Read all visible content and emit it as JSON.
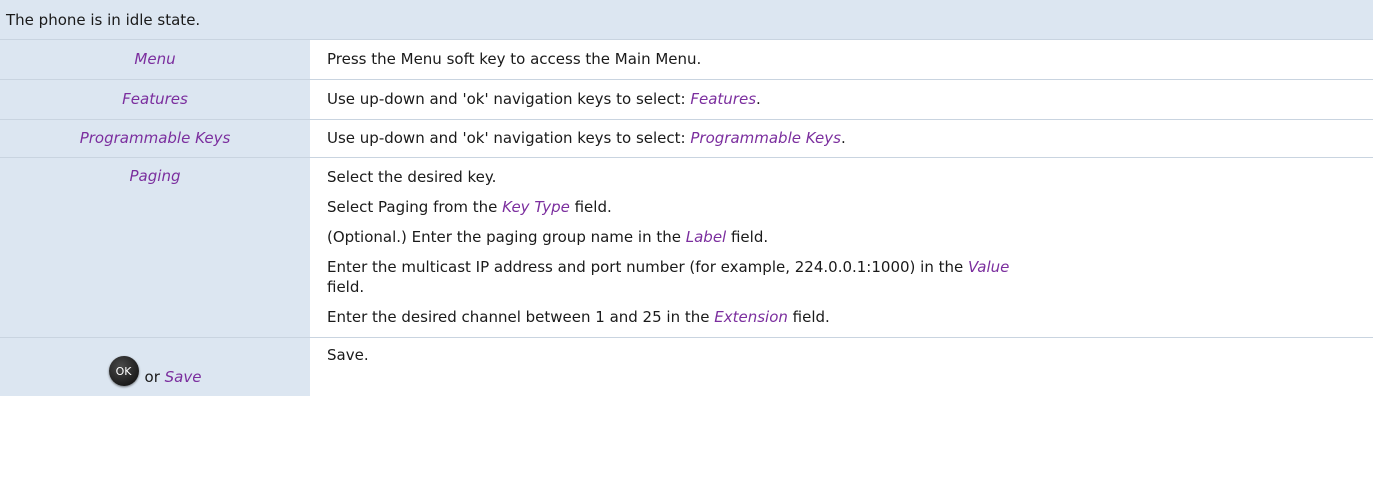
{
  "header": {
    "text": "The phone is in idle state."
  },
  "rows": [
    {
      "key": "Menu",
      "desc": "Press the Menu soft key to access the Main Menu."
    },
    {
      "key": "Features",
      "desc_prefix": "Use up-down and 'ok' navigation keys to select: ",
      "desc_italic": "Features",
      "desc_suffix": "."
    },
    {
      "key": "Programmable Keys",
      "desc_prefix": "Use up-down and 'ok' navigation keys to select: ",
      "desc_italic": "Programmable Keys",
      "desc_suffix": "."
    },
    {
      "key": "Paging",
      "lines": {
        "l1": "Select the desired key.",
        "l2_prefix": "Select Paging from the ",
        "l2_italic": "Key Type",
        "l2_suffix": " field.",
        "l3_prefix": "(Optional.) Enter the paging group name in the ",
        "l3_italic": "Label",
        "l3_suffix": " field.",
        "l4_prefix": "Enter the multicast IP address and port number (for example, 224.0.0.1:1000) in the ",
        "l4_italic": "Value",
        "l4_suffix": "field.",
        "l5_prefix": "Enter the desired channel between 1 and 25 in the ",
        "l5_italic": "Extension",
        "l5_suffix": " field."
      }
    },
    {
      "ok_label": "OK",
      "or_text": "or",
      "key": "Save",
      "desc": "Save."
    }
  ],
  "colors": {
    "header_bg": "#dce6f1",
    "italic_accent": "#7b2e9e"
  }
}
